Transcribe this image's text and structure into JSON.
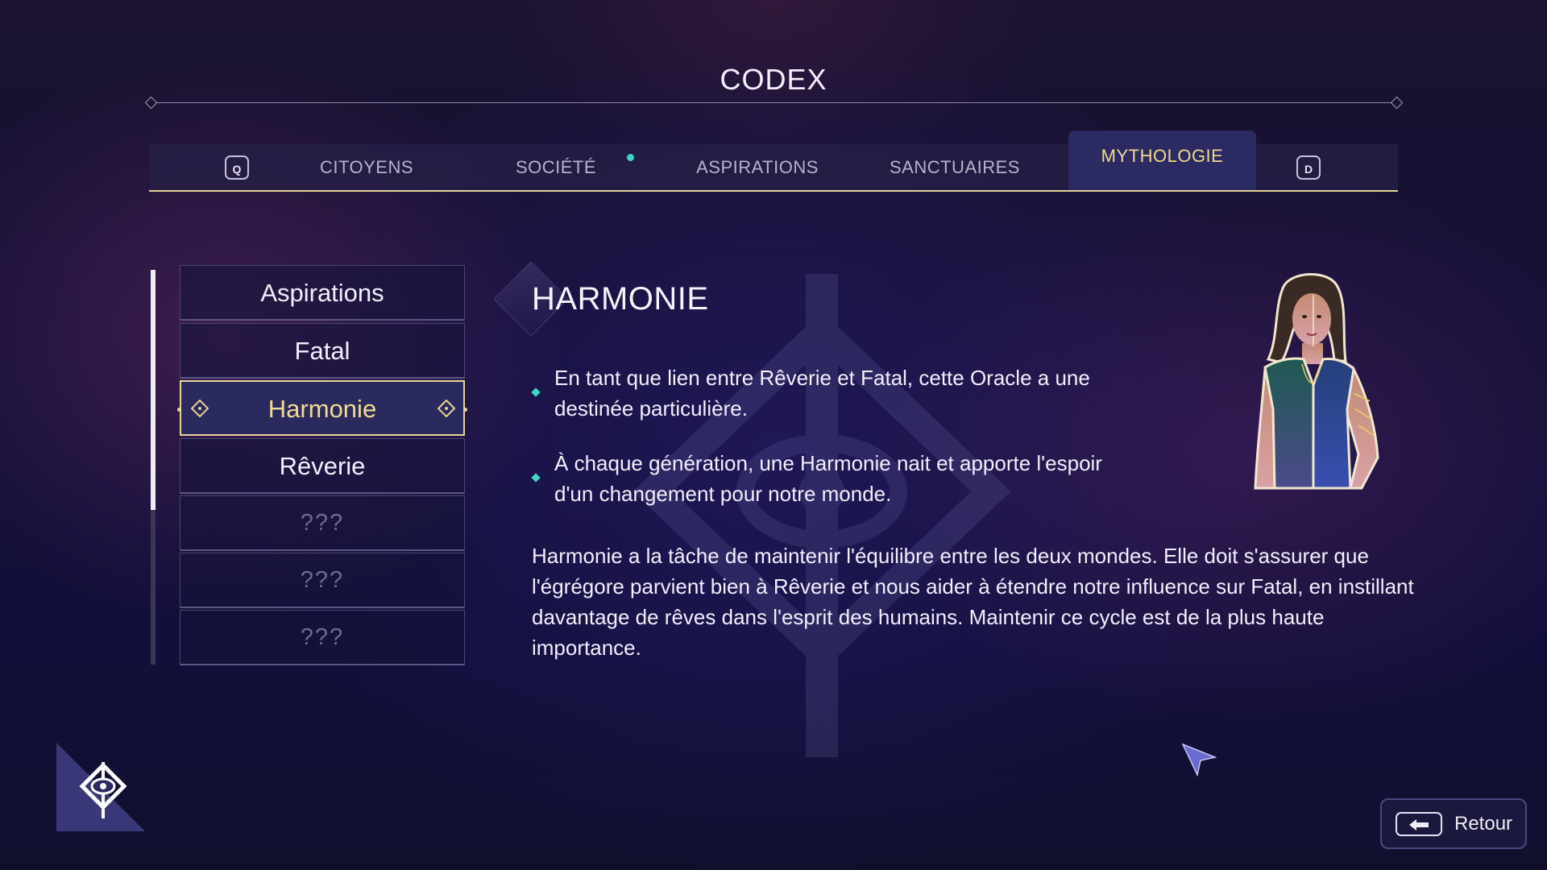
{
  "title": "CODEX",
  "tabs": {
    "prev_key": "Q",
    "next_key": "D",
    "items": [
      {
        "label": "CITOYENS"
      },
      {
        "label": "SOCIÉTÉ"
      },
      {
        "label": "ASPIRATIONS"
      },
      {
        "label": "SANCTUAIRES"
      },
      {
        "label": "MYTHOLOGIE"
      }
    ],
    "active": "MYTHOLOGIE",
    "notification_tab": "SOCIÉTÉ"
  },
  "list": {
    "items": [
      {
        "label": "Aspirations"
      },
      {
        "label": "Fatal"
      },
      {
        "label": "Harmonie"
      },
      {
        "label": "Rêverie"
      },
      {
        "label": "???"
      },
      {
        "label": "???"
      },
      {
        "label": "???"
      }
    ],
    "selected": "Harmonie"
  },
  "entry": {
    "heading": "HARMONIE",
    "bullets": [
      {
        "text": "En tant que lien entre Rêverie et Fatal, cette Oracle a une destinée particulière."
      },
      {
        "text": "À chaque génération, une Harmonie nait et apporte l'espoir d'un changement pour notre monde."
      }
    ],
    "paragraph": "Harmonie a la tâche de maintenir l'équilibre entre les deux mondes. Elle doit s'assurer que l'égrégore parvient bien à Rêverie et nous aider à étendre notre influence sur Fatal, en instillant davantage de rêves dans l'esprit des humains. Maintenir ce cycle est de la plus haute importance."
  },
  "back_button": {
    "label": "Retour"
  },
  "colors": {
    "accent_gold": "#e8d595",
    "accent_teal": "#3ed8c4",
    "active_tab_bg": "#2c2a62"
  },
  "icons": {
    "corner": "oracle-eye-icon",
    "cursor": "pointer-cursor-icon",
    "back": "arrow-left-icon"
  }
}
